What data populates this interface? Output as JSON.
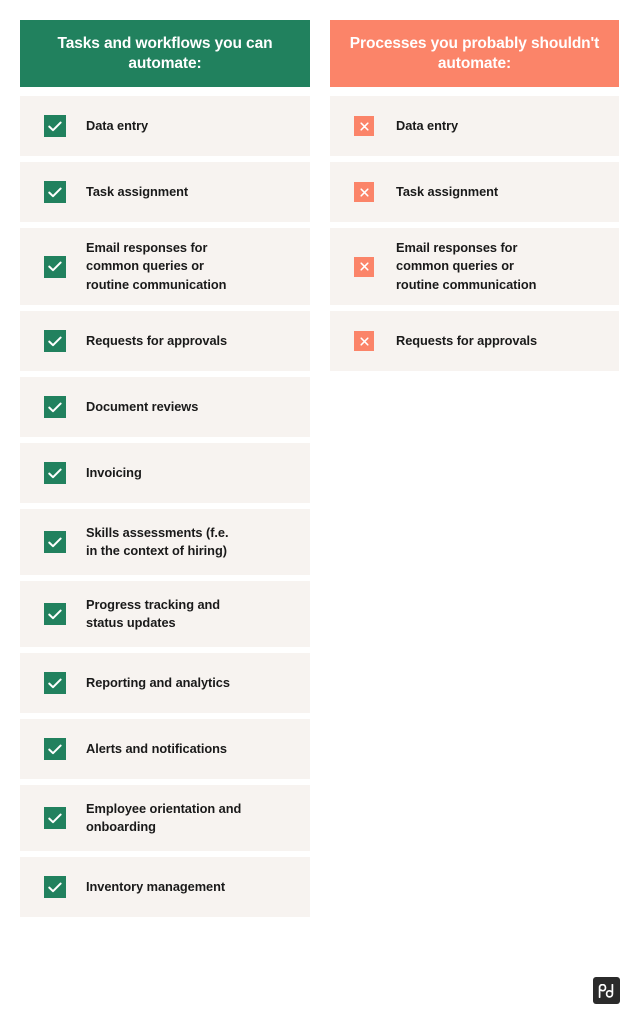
{
  "colors": {
    "green": "#21815E",
    "salmon": "#FB8469",
    "row_background": "#F7F3F0",
    "text": "#1A1A1A",
    "page_background": "#FFFFFF",
    "logo_background": "#2B2B2B"
  },
  "columns": [
    {
      "id": "can-automate",
      "header": "Tasks and workflows you can automate:",
      "header_color": "#21815E",
      "icon": "check-icon",
      "items": [
        {
          "label": "Data entry",
          "lines": 1
        },
        {
          "label": "Task assignment",
          "lines": 1
        },
        {
          "label": "Email responses for\ncommon queries or\nroutine communication",
          "lines": 3
        },
        {
          "label": "Requests for approvals",
          "lines": 1
        },
        {
          "label": "Document reviews",
          "lines": 1
        },
        {
          "label": "Invoicing",
          "lines": 1
        },
        {
          "label": "Skills assessments (f.e.\nin the context of hiring)",
          "lines": 2
        },
        {
          "label": "Progress tracking and\nstatus updates",
          "lines": 2
        },
        {
          "label": "Reporting and analytics",
          "lines": 1
        },
        {
          "label": "Alerts and notifications",
          "lines": 1
        },
        {
          "label": "Employee orientation and\nonboarding",
          "lines": 2
        },
        {
          "label": "Inventory management",
          "lines": 1
        }
      ]
    },
    {
      "id": "should-not-automate",
      "header": "Processes you probably shouldn't automate:",
      "header_color": "#FB8469",
      "icon": "cross-icon",
      "items": [
        {
          "label": "Data entry",
          "lines": 1
        },
        {
          "label": "Task assignment",
          "lines": 1
        },
        {
          "label": "Email responses for\ncommon queries or\nroutine communication",
          "lines": 3
        },
        {
          "label": "Requests for approvals",
          "lines": 1
        }
      ]
    }
  ],
  "logo": {
    "name": "pd-logo",
    "text": "pd"
  }
}
